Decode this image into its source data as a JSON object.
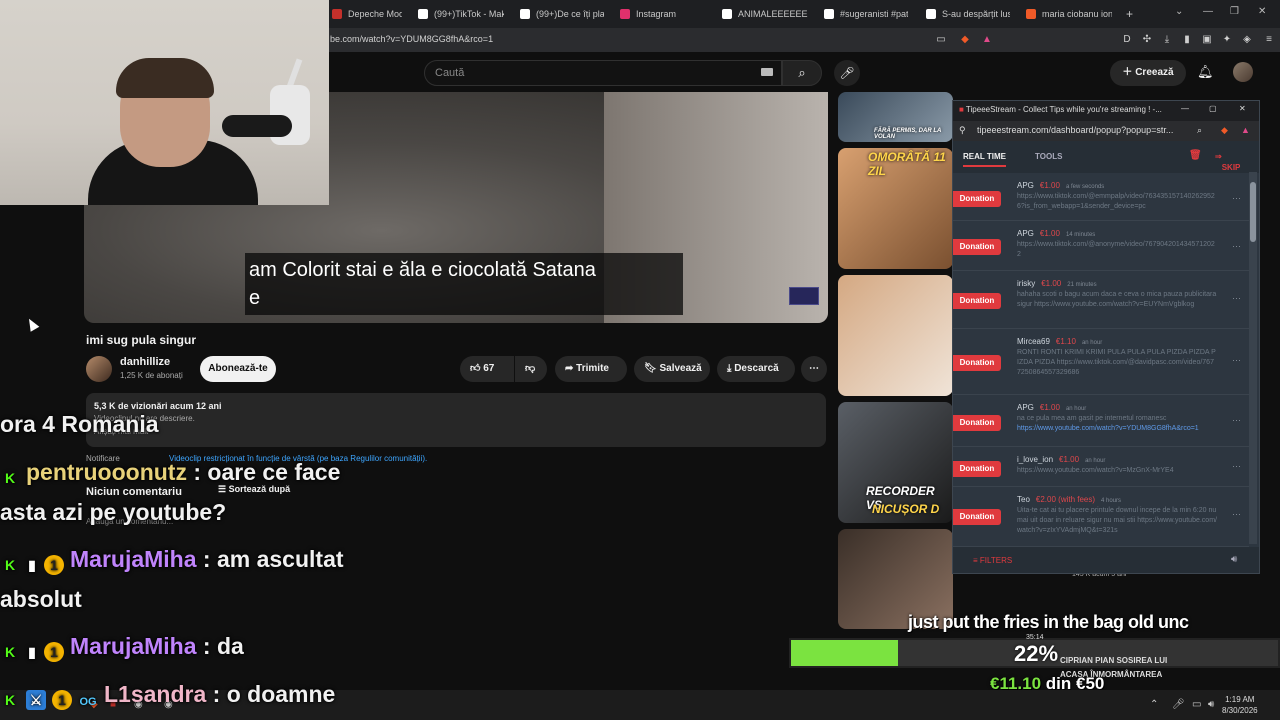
{
  "browser": {
    "tabs": [
      {
        "label": "Depeche Mode - P",
        "color": "#c4302b"
      },
      {
        "label": "(99+)TikTok - Make",
        "color": "#ffffff"
      },
      {
        "label": "(99+)De ce îți place",
        "color": "#ffffff"
      },
      {
        "label": "Instagram",
        "color": "#e1306c"
      },
      {
        "label": "ANIMALEEEEEEEEEE",
        "color": "#ffffff"
      },
      {
        "label": "#sugeranisti #patre",
        "color": "#ffffff"
      },
      {
        "label": "S-au despărțit lusti",
        "color": "#ffffff"
      },
      {
        "label": "maria ciobanu ion c",
        "color": "#f05a28"
      }
    ],
    "new_tab": "+",
    "url": "be.com/watch?v=YDUM8GG8fhA&rco=1"
  },
  "youtube": {
    "search_placeholder": "Caută",
    "create_label": "Creează",
    "caption_line1": "am Colorit stai e ăla e ciocolată Satana",
    "caption_line2": "e",
    "video_title": "imi sug pula singur",
    "channel_name": "danhillize",
    "channel_subs": "1,25 K de abonați",
    "subscribe_label": "Abonează-te",
    "likes": "67",
    "share_label": "Trimite",
    "save_label": "Salvează",
    "download_label": "Descarcă",
    "desc_stats": "5,3 K de vizionări  acum 12 ani",
    "desc_text": "Videoclipul nu are descriere.",
    "desc_more": "Afișați mai mult",
    "notice_label": "Notificare",
    "notice_text": "Videoclip restricționat în funcție de vârstă (pe baza Regulilor comunității).",
    "comments_label": "Niciun comentariu",
    "sort_label": "Sortează după",
    "add_comment": "Adaugă un comentariu...",
    "rec_labels": [
      "FĂRĂ PERMIS, DAR LA VOLAN",
      "OMORÂTĂ 11 ZIL",
      "RECORDER VS",
      "NICUȘOR D"
    ],
    "rec_meta": "145 K   acum 5 ani"
  },
  "chat": [
    {
      "user": "",
      "text": "ora 4 Romania",
      "color": "#ffffff"
    },
    {
      "user": "pentruooonutz",
      "text": " : oare ce face",
      "color": "#e8d27a"
    },
    {
      "user": "",
      "text": "asta azi pe youtube?",
      "color": "#ffffff"
    },
    {
      "user": "MarujaMiha",
      "text": " : am ascultat",
      "color": "#c084fc"
    },
    {
      "user": "",
      "text": "absolut",
      "color": "#ffffff"
    },
    {
      "user": "MarujaMiha",
      "text": " : da",
      "color": "#c084fc"
    },
    {
      "user": "L1sandra",
      "text": " : o doamne",
      "color": "#f0b6c8"
    }
  ],
  "tipeee": {
    "window_title": "TipeeeStream - Collect Tips while you're streaming ! -...",
    "url": "tipeeestream.com/dashboard/popup?popup=str...",
    "tab_realtime": "REAL TIME",
    "tab_tools": "TOOLS",
    "skip_label": "SKIP",
    "donation_label": "Donation",
    "filters_label": "FILTERS",
    "donations": [
      {
        "name": "APG",
        "amount": "€1.00",
        "time": "a few seconds",
        "msg": "https://www.tiktok.com/@emmpalp/video/7634351571402629526?is_from_webapp=1&sender_device=pc"
      },
      {
        "name": "APG",
        "amount": "€1.00",
        "time": "14 minutes",
        "msg": "https://www.tiktok.com/@anonyme/video/7679042014345712022"
      },
      {
        "name": "irisky",
        "amount": "€1.00",
        "time": "21 minutes",
        "msg": "hahaha scoti o bagu acum daca e ceva o mica pauza publicitara sigur https://www.youtube.com/watch?v=EUYNmVgblkog"
      },
      {
        "name": "Mircea69",
        "amount": "€1.10",
        "time": "an hour",
        "msg": "RONTI RONTI KRIMI KRIMI PULA PULA PULA PIZDA PIZDA PIZDA PIZDA https://www.tiktok.com/@davidpasc.com/video/7677250864557329686"
      },
      {
        "name": "APG",
        "amount": "€1.00",
        "time": "an hour",
        "msg": "na ce pula mea am gasit pe internetul romanesc",
        "link": "https://www.youtube.com/watch?v=YDUM8GG8fhA&rco=1"
      },
      {
        "name": "i_love_ion",
        "amount": "€1.00",
        "time": "an hour",
        "msg": "https://www.youtube.com/watch?v=MzGnX-MrYE4"
      },
      {
        "name": "Teo",
        "amount": "€2.00 (with fees)",
        "time": "4 hours",
        "msg": "Uita-te cat ai tu placere printule downul incepe de la min 6:20 nu mai uit doar in reluare sigur nu mai stii https://www.youtube.com/watch?v=zIxYVAdmjMQ&t=321s"
      }
    ]
  },
  "overlay": {
    "fries_text": "just put the fries in the bag old unc",
    "goal_percent": 22,
    "goal_percent_label": "22%",
    "goal_current": "€11.10",
    "goal_sep": " din ",
    "goal_target": "€50",
    "goal_title1": "CIPRIAN PIAN SOSIREA LUI",
    "goal_title2": "ACASA ÎNMORMÂNTAREA",
    "small_time": "35:14"
  },
  "taskbar": {
    "time": "1:19 AM",
    "date": "8/30/2026"
  }
}
